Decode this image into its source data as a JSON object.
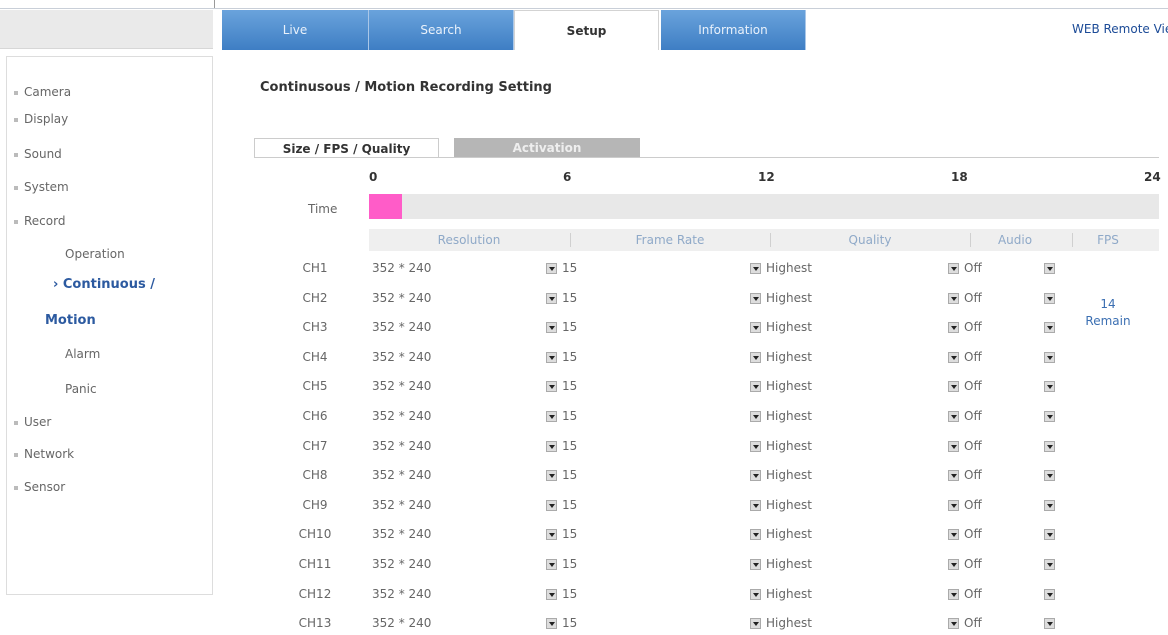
{
  "nav": {
    "tabs": [
      {
        "label": "Live"
      },
      {
        "label": "Search"
      },
      {
        "label": "Setup"
      },
      {
        "label": "Information"
      }
    ],
    "remote_label": "WEB Remote Vie"
  },
  "sidebar": {
    "items": [
      {
        "label": "Camera"
      },
      {
        "label": "Display"
      },
      {
        "label": "Sound"
      },
      {
        "label": "System"
      },
      {
        "label": "Record"
      },
      {
        "label": "User"
      },
      {
        "label": "Network"
      },
      {
        "label": "Sensor"
      }
    ],
    "record_sub": [
      {
        "label": "Operation"
      },
      {
        "label": "Alarm"
      },
      {
        "label": "Panic"
      }
    ],
    "active_line1": "› Continuous /",
    "active_line2": "Motion"
  },
  "page": {
    "title": "Continusous / Motion Recording Setting",
    "subtabs": [
      {
        "label": "Size / FPS / Quality"
      },
      {
        "label": "Activation"
      }
    ]
  },
  "schedule": {
    "time_label": "Time",
    "scale": [
      "0",
      "6",
      "12",
      "18",
      "24"
    ]
  },
  "table": {
    "headers": [
      "Resolution",
      "Frame Rate",
      "Quality",
      "Audio",
      "FPS"
    ],
    "rows": [
      {
        "ch": "CH1",
        "res": "352 * 240",
        "fr": "15",
        "q": "Highest",
        "a": "Off"
      },
      {
        "ch": "CH2",
        "res": "352 * 240",
        "fr": "15",
        "q": "Highest",
        "a": "Off"
      },
      {
        "ch": "CH3",
        "res": "352 * 240",
        "fr": "15",
        "q": "Highest",
        "a": "Off"
      },
      {
        "ch": "CH4",
        "res": "352 * 240",
        "fr": "15",
        "q": "Highest",
        "a": "Off"
      },
      {
        "ch": "CH5",
        "res": "352 * 240",
        "fr": "15",
        "q": "Highest",
        "a": "Off"
      },
      {
        "ch": "CH6",
        "res": "352 * 240",
        "fr": "15",
        "q": "Highest",
        "a": "Off"
      },
      {
        "ch": "CH7",
        "res": "352 * 240",
        "fr": "15",
        "q": "Highest",
        "a": "Off"
      },
      {
        "ch": "CH8",
        "res": "352 * 240",
        "fr": "15",
        "q": "Highest",
        "a": "Off"
      },
      {
        "ch": "CH9",
        "res": "352 * 240",
        "fr": "15",
        "q": "Highest",
        "a": "Off"
      },
      {
        "ch": "CH10",
        "res": "352 * 240",
        "fr": "15",
        "q": "Highest",
        "a": "Off"
      },
      {
        "ch": "CH11",
        "res": "352 * 240",
        "fr": "15",
        "q": "Highest",
        "a": "Off"
      },
      {
        "ch": "CH12",
        "res": "352 * 240",
        "fr": "15",
        "q": "Highest",
        "a": "Off"
      },
      {
        "ch": "CH13",
        "res": "352 * 240",
        "fr": "15",
        "q": "Highest",
        "a": "Off"
      }
    ],
    "fps_remain_value": "14",
    "fps_remain_text": "Remain"
  },
  "icons": [
    "dropdown-arrow-icon",
    "bullet-icon"
  ],
  "colors": {
    "tab": "#4f8fd3",
    "active_nav": "#2c5aa0",
    "schedule_mark": "#ff5cc8"
  }
}
